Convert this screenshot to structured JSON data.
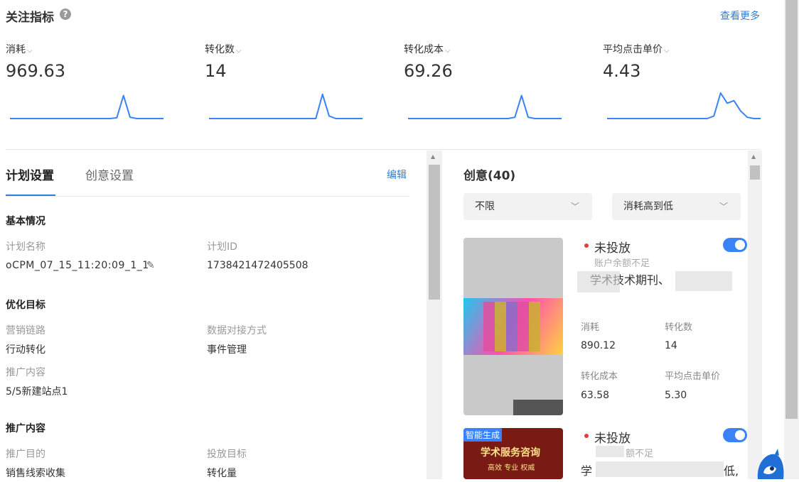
{
  "header": {
    "title": "关注指标",
    "help_icon": "?",
    "see_more": "查看更多"
  },
  "metrics": [
    {
      "label": "消耗",
      "value": "969.63",
      "spark": [
        0,
        0,
        0,
        0,
        0,
        0,
        0,
        0,
        0,
        0,
        0,
        0,
        0,
        0,
        0,
        0,
        0.03,
        0.9,
        0.05,
        0,
        0,
        0,
        0,
        0
      ]
    },
    {
      "label": "转化数",
      "value": "14",
      "spark": [
        0,
        0,
        0,
        0,
        0,
        0,
        0,
        0,
        0,
        0,
        0,
        0,
        0,
        0,
        0,
        0,
        0,
        0.95,
        0.1,
        0,
        0,
        0,
        0,
        0
      ]
    },
    {
      "label": "转化成本",
      "value": "69.26",
      "spark": [
        0,
        0,
        0,
        0,
        0,
        0,
        0,
        0,
        0,
        0,
        0,
        0,
        0,
        0,
        0,
        0,
        0.05,
        0.9,
        0.05,
        0,
        0,
        0,
        0,
        0
      ]
    },
    {
      "label": "平均点击单价",
      "value": "4.43",
      "spark": [
        0,
        0,
        0,
        0,
        0,
        0,
        0,
        0,
        0,
        0,
        0,
        0,
        0,
        0,
        0,
        0,
        0.1,
        1.0,
        0.6,
        0.7,
        0.3,
        0.05,
        0,
        0
      ]
    }
  ],
  "metric_chevron": "⌵",
  "plan_tabs": {
    "active": "计划设置",
    "inactive": "创意设置",
    "edit": "编辑"
  },
  "plan": {
    "basic_title": "基本情况",
    "name_label": "计划名称",
    "name_value": "oCPM_07_15_11:20:09_1_1",
    "id_label": "计划ID",
    "id_value": "1738421472405508",
    "opt_title": "优化目标",
    "chain_label": "营销链路",
    "chain_value": "行动转化",
    "data_label": "数据对接方式",
    "data_value": "事件管理",
    "content_label": "推广内容",
    "content_value": "5/5新建站点1",
    "promo_title": "推广内容",
    "purpose_label": "推广目的",
    "purpose_value": "销售线索收集",
    "target_label": "投放目标",
    "target_value": "转化量"
  },
  "creative": {
    "title": "创意(40)",
    "filter1": "不限",
    "filter2": "消耗高到低",
    "cards": [
      {
        "status": "未投放",
        "warning": "账户余额不足",
        "name": "学术技术期刊、",
        "stats": [
          {
            "label": "消耗",
            "value": "890.12"
          },
          {
            "label": "转化数",
            "value": "14"
          },
          {
            "label": "转化成本",
            "value": "63.58"
          },
          {
            "label": "平均点击单价",
            "value": "5.30"
          }
        ]
      },
      {
        "status": "未投放",
        "warning": "额不足",
        "badge": "智能生成",
        "thumb_line1": "学术服务咨询",
        "thumb_line2": "高效 专业 权威",
        "name_start": "学",
        "name_end": "低,"
      }
    ]
  },
  "colors": {
    "accent": "#2f7fd6",
    "toggle": "#3a82f7",
    "spark": "#3a82f7",
    "status_dot": "#e23c3c"
  }
}
